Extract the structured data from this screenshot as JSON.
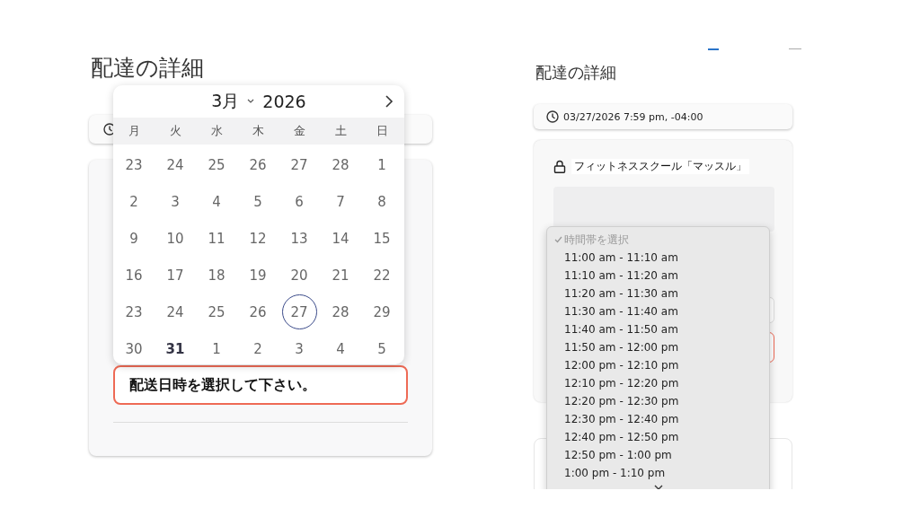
{
  "left": {
    "title": "配達の詳細",
    "calendar": {
      "month": "3月",
      "year": "2026",
      "weekdays": [
        "月",
        "火",
        "水",
        "木",
        "金",
        "土",
        "日"
      ],
      "weeks": [
        [
          {
            "day": "23",
            "selected": false,
            "emphasized": false
          },
          {
            "day": "24",
            "selected": false,
            "emphasized": false
          },
          {
            "day": "25",
            "selected": false,
            "emphasized": false
          },
          {
            "day": "26",
            "selected": false,
            "emphasized": false
          },
          {
            "day": "27",
            "selected": false,
            "emphasized": false
          },
          {
            "day": "28",
            "selected": false,
            "emphasized": false
          },
          {
            "day": "1",
            "selected": false,
            "emphasized": false
          }
        ],
        [
          {
            "day": "2",
            "selected": false,
            "emphasized": false
          },
          {
            "day": "3",
            "selected": false,
            "emphasized": false
          },
          {
            "day": "4",
            "selected": false,
            "emphasized": false
          },
          {
            "day": "5",
            "selected": false,
            "emphasized": false
          },
          {
            "day": "6",
            "selected": false,
            "emphasized": false
          },
          {
            "day": "7",
            "selected": false,
            "emphasized": false
          },
          {
            "day": "8",
            "selected": false,
            "emphasized": false
          }
        ],
        [
          {
            "day": "9",
            "selected": false,
            "emphasized": false
          },
          {
            "day": "10",
            "selected": false,
            "emphasized": false
          },
          {
            "day": "11",
            "selected": false,
            "emphasized": false
          },
          {
            "day": "12",
            "selected": false,
            "emphasized": false
          },
          {
            "day": "13",
            "selected": false,
            "emphasized": false
          },
          {
            "day": "14",
            "selected": false,
            "emphasized": false
          },
          {
            "day": "15",
            "selected": false,
            "emphasized": false
          }
        ],
        [
          {
            "day": "16",
            "selected": false,
            "emphasized": false
          },
          {
            "day": "17",
            "selected": false,
            "emphasized": false
          },
          {
            "day": "18",
            "selected": false,
            "emphasized": false
          },
          {
            "day": "19",
            "selected": false,
            "emphasized": false
          },
          {
            "day": "20",
            "selected": false,
            "emphasized": false
          },
          {
            "day": "21",
            "selected": false,
            "emphasized": false
          },
          {
            "day": "22",
            "selected": false,
            "emphasized": false
          }
        ],
        [
          {
            "day": "23",
            "selected": false,
            "emphasized": false
          },
          {
            "day": "24",
            "selected": false,
            "emphasized": false
          },
          {
            "day": "25",
            "selected": false,
            "emphasized": false
          },
          {
            "day": "26",
            "selected": false,
            "emphasized": false
          },
          {
            "day": "27",
            "selected": true,
            "emphasized": false
          },
          {
            "day": "28",
            "selected": false,
            "emphasized": false
          },
          {
            "day": "29",
            "selected": false,
            "emphasized": false
          }
        ],
        [
          {
            "day": "30",
            "selected": false,
            "emphasized": false
          },
          {
            "day": "31",
            "selected": false,
            "emphasized": true
          },
          {
            "day": "1",
            "selected": false,
            "emphasized": false
          },
          {
            "day": "2",
            "selected": false,
            "emphasized": false
          },
          {
            "day": "3",
            "selected": false,
            "emphasized": false
          },
          {
            "day": "4",
            "selected": false,
            "emphasized": false
          },
          {
            "day": "5",
            "selected": false,
            "emphasized": false
          }
        ]
      ]
    },
    "error_message": "配送日時を選択して下さい。"
  },
  "right": {
    "title": "配達の詳細",
    "datetime": "03/27/2026 7:59 pm, -04:00",
    "location": "フィットネススクール「マッスル」",
    "time_slots": [
      {
        "label": "時間帯を選択",
        "selected": true,
        "disabled": true
      },
      {
        "label": "11:00 am - 11:10 am",
        "selected": false,
        "disabled": false
      },
      {
        "label": "11:10 am - 11:20 am",
        "selected": false,
        "disabled": false
      },
      {
        "label": "11:20 am - 11:30 am",
        "selected": false,
        "disabled": false
      },
      {
        "label": "11:30 am - 11:40 am",
        "selected": false,
        "disabled": false
      },
      {
        "label": "11:40 am - 11:50 am",
        "selected": false,
        "disabled": false
      },
      {
        "label": "11:50 am - 12:00 pm",
        "selected": false,
        "disabled": false
      },
      {
        "label": "12:00 pm - 12:10 pm",
        "selected": false,
        "disabled": false
      },
      {
        "label": "12:10 pm - 12:20 pm",
        "selected": false,
        "disabled": false
      },
      {
        "label": "12:20 pm - 12:30 pm",
        "selected": false,
        "disabled": false
      },
      {
        "label": "12:30 pm - 12:40 pm",
        "selected": false,
        "disabled": false
      },
      {
        "label": "12:40 pm - 12:50 pm",
        "selected": false,
        "disabled": false
      },
      {
        "label": "12:50 pm - 1:00 pm",
        "selected": false,
        "disabled": false
      },
      {
        "label": "1:00 pm - 1:10 pm",
        "selected": false,
        "disabled": false
      }
    ]
  }
}
